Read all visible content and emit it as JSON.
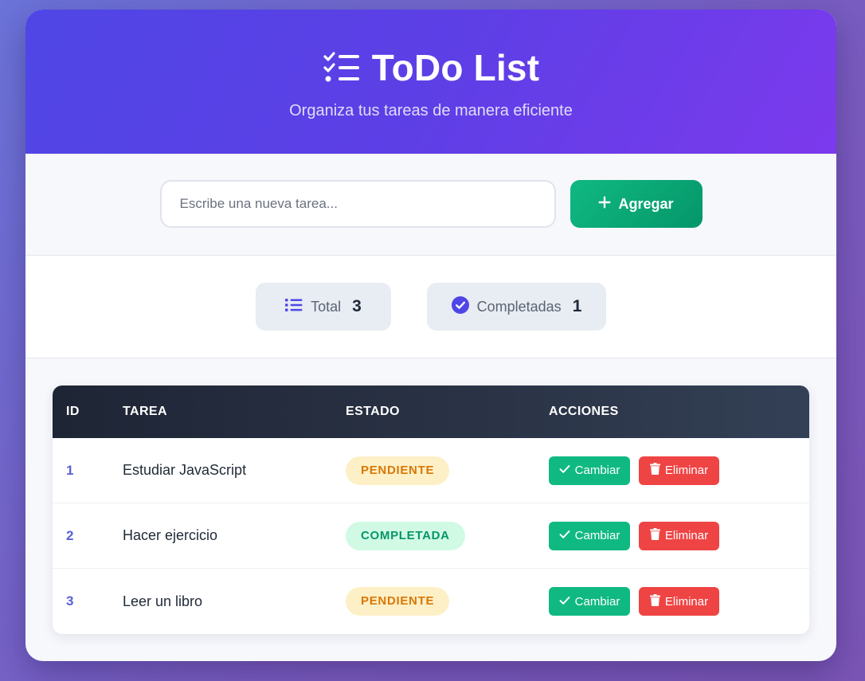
{
  "header": {
    "title": "ToDo List",
    "subtitle": "Organiza tus tareas de manera eficiente",
    "icon": "tasks-icon"
  },
  "add_form": {
    "placeholder": "Escribe una nueva tarea...",
    "value": "",
    "button_label": "Agregar",
    "button_icon": "plus-icon"
  },
  "stats": {
    "total": {
      "label": "Total",
      "value": "3",
      "icon": "list-icon"
    },
    "completed": {
      "label": "Completadas",
      "value": "1",
      "icon": "check-circle-icon"
    }
  },
  "table": {
    "headers": {
      "id": "ID",
      "task": "TAREA",
      "status": "ESTADO",
      "actions": "ACCIONES"
    },
    "rows": [
      {
        "id": "1",
        "task": "Estudiar JavaScript",
        "status": "PENDIENTE",
        "toggle_label": "Cambiar",
        "delete_label": "Eliminar"
      },
      {
        "id": "2",
        "task": "Hacer ejercicio",
        "status": "COMPLETADA",
        "toggle_label": "Cambiar",
        "delete_label": "Eliminar"
      },
      {
        "id": "3",
        "task": "Leer un libro",
        "status": "PENDIENTE",
        "toggle_label": "Cambiar",
        "delete_label": "Eliminar"
      }
    ]
  },
  "colors": {
    "header_gradient_start": "#4f46e5",
    "header_gradient_end": "#7c3aed",
    "add_button": "#10b981",
    "toggle_button": "#10b981",
    "delete_button": "#ef4444",
    "pending_badge_text": "#d97706",
    "completed_badge_text": "#059669"
  }
}
